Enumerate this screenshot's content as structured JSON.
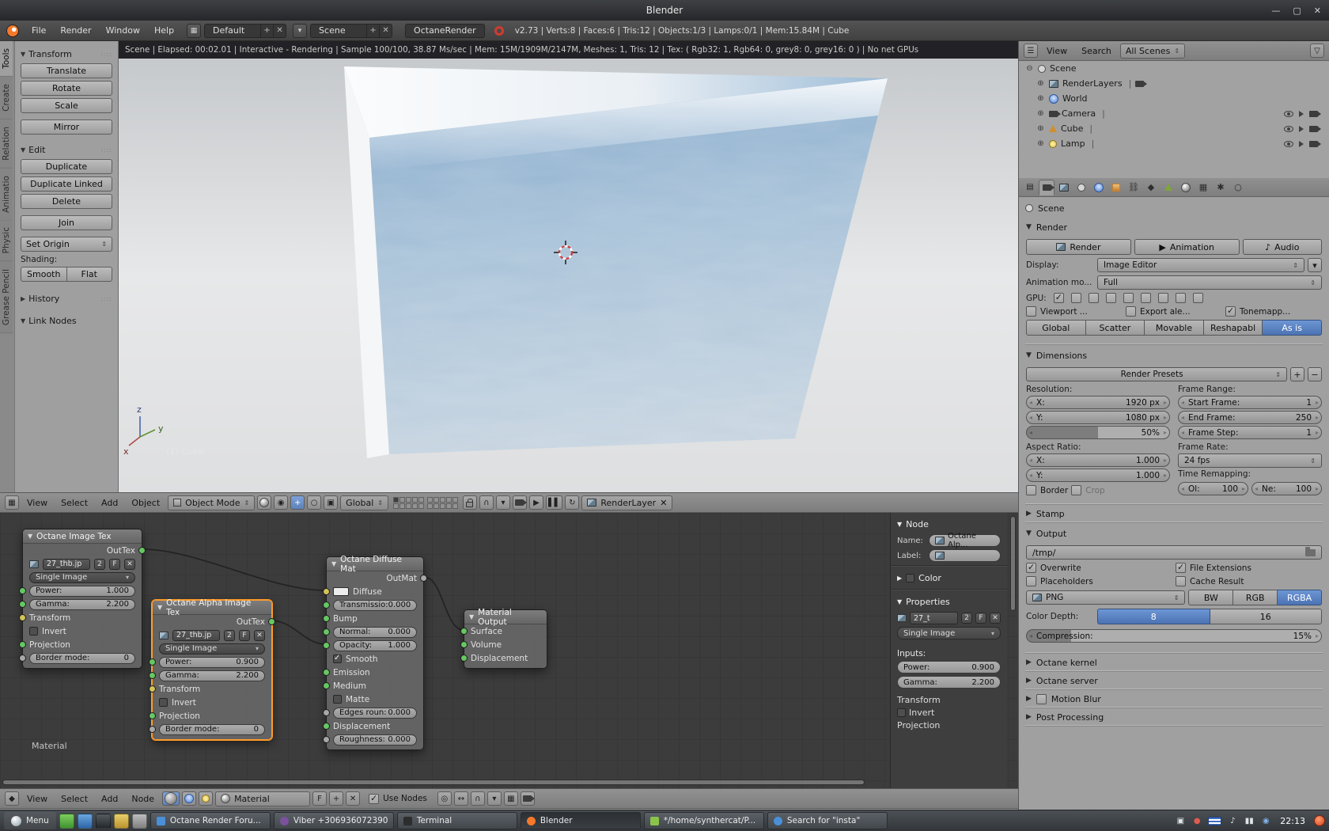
{
  "titlebar": {
    "title": "Blender"
  },
  "menubar": {
    "file": "File",
    "render": "Render",
    "window": "Window",
    "help": "Help",
    "layout": "Default",
    "scene": "Scene",
    "engine": "OctaneRender",
    "stats": "v2.73 | Verts:8 | Faces:6 | Tris:12 | Objects:1/3 | Lamps:0/1 | Mem:15.84M | Cube"
  },
  "tool_tabs": [
    {
      "label": "Tools"
    },
    {
      "label": "Create"
    },
    {
      "label": "Relation"
    },
    {
      "label": "Animatio"
    },
    {
      "label": "Physic"
    },
    {
      "label": "Grease Pencil"
    }
  ],
  "tool_shelf": {
    "transform_title": "Transform",
    "translate": "Translate",
    "rotate": "Rotate",
    "scale": "Scale",
    "mirror": "Mirror",
    "edit_title": "Edit",
    "duplicate": "Duplicate",
    "duplicate_linked": "Duplicate Linked",
    "delete": "Delete",
    "join": "Join",
    "set_origin": "Set Origin",
    "shading_label": "Shading:",
    "smooth": "Smooth",
    "flat": "Flat",
    "history_title": "History",
    "link_nodes_title": "Link Nodes"
  },
  "viewport": {
    "render_stats": "Scene | Elapsed: 00:02.01 | Interactive - Rendering | Sample 100/100, 38.87 Ms/sec | Mem: 15M/1909M/2147M, Meshes: 1, Tris: 12 | Tex: ( Rgb32: 1, Rgb64: 0, grey8: 0, grey16: 0 ) | No net GPUs",
    "object_label": "(1) Cube",
    "axis_x": "x",
    "axis_y": "y",
    "axis_z": "z",
    "header": {
      "view": "View",
      "select": "Select",
      "add": "Add",
      "object": "Object",
      "mode": "Object Mode",
      "orientation": "Global",
      "render_layer": "RenderLayer"
    }
  },
  "node_editor": {
    "breadcrumb": "Material",
    "image_tex": {
      "title": "Octane Image Tex",
      "out": "OutTex",
      "image": "27_thb.jp",
      "users": "2",
      "fake": "F",
      "source": "Single Image",
      "power_label": "Power:",
      "power_value": "1.000",
      "gamma_label": "Gamma:",
      "gamma_value": "2.200",
      "transform": "Transform",
      "invert": "Invert",
      "projection": "Projection",
      "border_label": "Border mode:",
      "border_value": "0"
    },
    "alpha_tex": {
      "title": "Octane Alpha Image Tex",
      "out": "OutTex",
      "image": "27_thb.jp",
      "users": "2",
      "fake": "F",
      "source": "Single Image",
      "power_label": "Power:",
      "power_value": "0.900",
      "gamma_label": "Gamma:",
      "gamma_value": "2.200",
      "transform": "Transform",
      "invert": "Invert",
      "projection": "Projection",
      "border_label": "Border mode:",
      "border_value": "0"
    },
    "diffuse": {
      "title": "Octane Diffuse Mat",
      "out": "OutMat",
      "diffuse": "Diffuse",
      "transmission_label": "Transmissio:",
      "transmission_value": "0.000",
      "bump": "Bump",
      "normal_label": "Normal:",
      "normal_value": "0.000",
      "opacity_label": "Opacity:",
      "opacity_value": "1.000",
      "smooth": "Smooth",
      "emission": "Emission",
      "medium": "Medium",
      "matte": "Matte",
      "edges_label": "Edges roun:",
      "edges_value": "0.000",
      "displacement": "Displacement",
      "roughness_label": "Roughness:",
      "roughness_value": "0.000"
    },
    "material_output": {
      "title": "Material Output",
      "surface": "Surface",
      "volume": "Volume",
      "displacement": "Displacement"
    },
    "npanel": {
      "node_title": "Node",
      "name_label": "Name:",
      "name_value": "Octane Alp...",
      "label_label": "Label:",
      "color_title": "Color",
      "properties_title": "Properties",
      "image": "27_t",
      "users": "2",
      "fake": "F",
      "source": "Single Image",
      "inputs_label": "Inputs:",
      "power_label": "Power:",
      "power_value": "0.900",
      "gamma_label": "Gamma:",
      "gamma_value": "2.200",
      "transform": "Transform",
      "invert": "Invert",
      "projection": "Projection"
    },
    "header": {
      "view": "View",
      "select": "Select",
      "add": "Add",
      "node": "Node",
      "material": "Material",
      "fake": "F",
      "use_nodes": "Use Nodes"
    }
  },
  "outliner": {
    "view": "View",
    "search": "Search",
    "scope": "All Scenes",
    "divider": "|",
    "scene": "Scene",
    "render_layers": "RenderLayers",
    "world": "World",
    "camera": "Camera",
    "cube": "Cube",
    "lamp": "Lamp"
  },
  "properties": {
    "breadcrumb": "Scene",
    "render_title": "Render",
    "render_btn": "Render",
    "animation_btn": "Animation",
    "audio_btn": "Audio",
    "display_label": "Display:",
    "display_value": "Image Editor",
    "anim_label": "Animation mo...",
    "anim_value": "Full",
    "gpu_label": "GPU:",
    "viewport_cb": "Viewport ...",
    "export_cb": "Export ale...",
    "tonemap_cb": "Tonemapp...",
    "mode_global": "Global",
    "mode_scatter": "Scatter",
    "mode_movable": "Movable",
    "mode_reshapable": "Reshapabl",
    "mode_asis": "As is",
    "dimensions_title": "Dimensions",
    "presets": "Render Presets",
    "resolution_label": "Resolution:",
    "res_x_label": "X:",
    "res_x_value": "1920 px",
    "res_y_label": "Y:",
    "res_y_value": "1080 px",
    "res_pct": "50%",
    "frame_range_label": "Frame Range:",
    "start_label": "Start Frame:",
    "start_value": "1",
    "end_label": "End Frame:",
    "end_value": "250",
    "step_label": "Frame Step:",
    "step_value": "1",
    "aspect_label": "Aspect Ratio:",
    "aspect_x_label": "X:",
    "aspect_x_value": "1.000",
    "aspect_y_label": "Y:",
    "aspect_y_value": "1.000",
    "framerate_label": "Frame Rate:",
    "framerate_value": "24 fps",
    "border_cb": "Border",
    "crop_cb": "Crop",
    "remap_label": "Time Remapping:",
    "old_label": "Ol:",
    "old_value": "100",
    "new_label": "Ne:",
    "new_value": "100",
    "stamp_title": "Stamp",
    "output_title": "Output",
    "path": "/tmp/",
    "overwrite_cb": "Overwrite",
    "extensions_cb": "File Extensions",
    "placeholders_cb": "Placeholders",
    "cache_cb": "Cache Result",
    "format_value": "PNG",
    "bw": "BW",
    "rgb": "RGB",
    "rgba": "RGBA",
    "depth_label": "Color Depth:",
    "depth8": "8",
    "depth16": "16",
    "compression_label": "Compression:",
    "compression_value": "15%",
    "kernel_title": "Octane kernel",
    "server_title": "Octane server",
    "motion_title": "Motion Blur",
    "post_title": "Post Processing"
  },
  "taskbar": {
    "menu": "Menu",
    "time": "22:13",
    "windows": [
      {
        "label": "Octane Render Foru..."
      },
      {
        "label": "Viber +306936072390"
      },
      {
        "label": "Terminal"
      },
      {
        "label": "Blender"
      },
      {
        "label": "*/home/synthercat/P..."
      },
      {
        "label": "Search for \"insta\""
      }
    ]
  }
}
